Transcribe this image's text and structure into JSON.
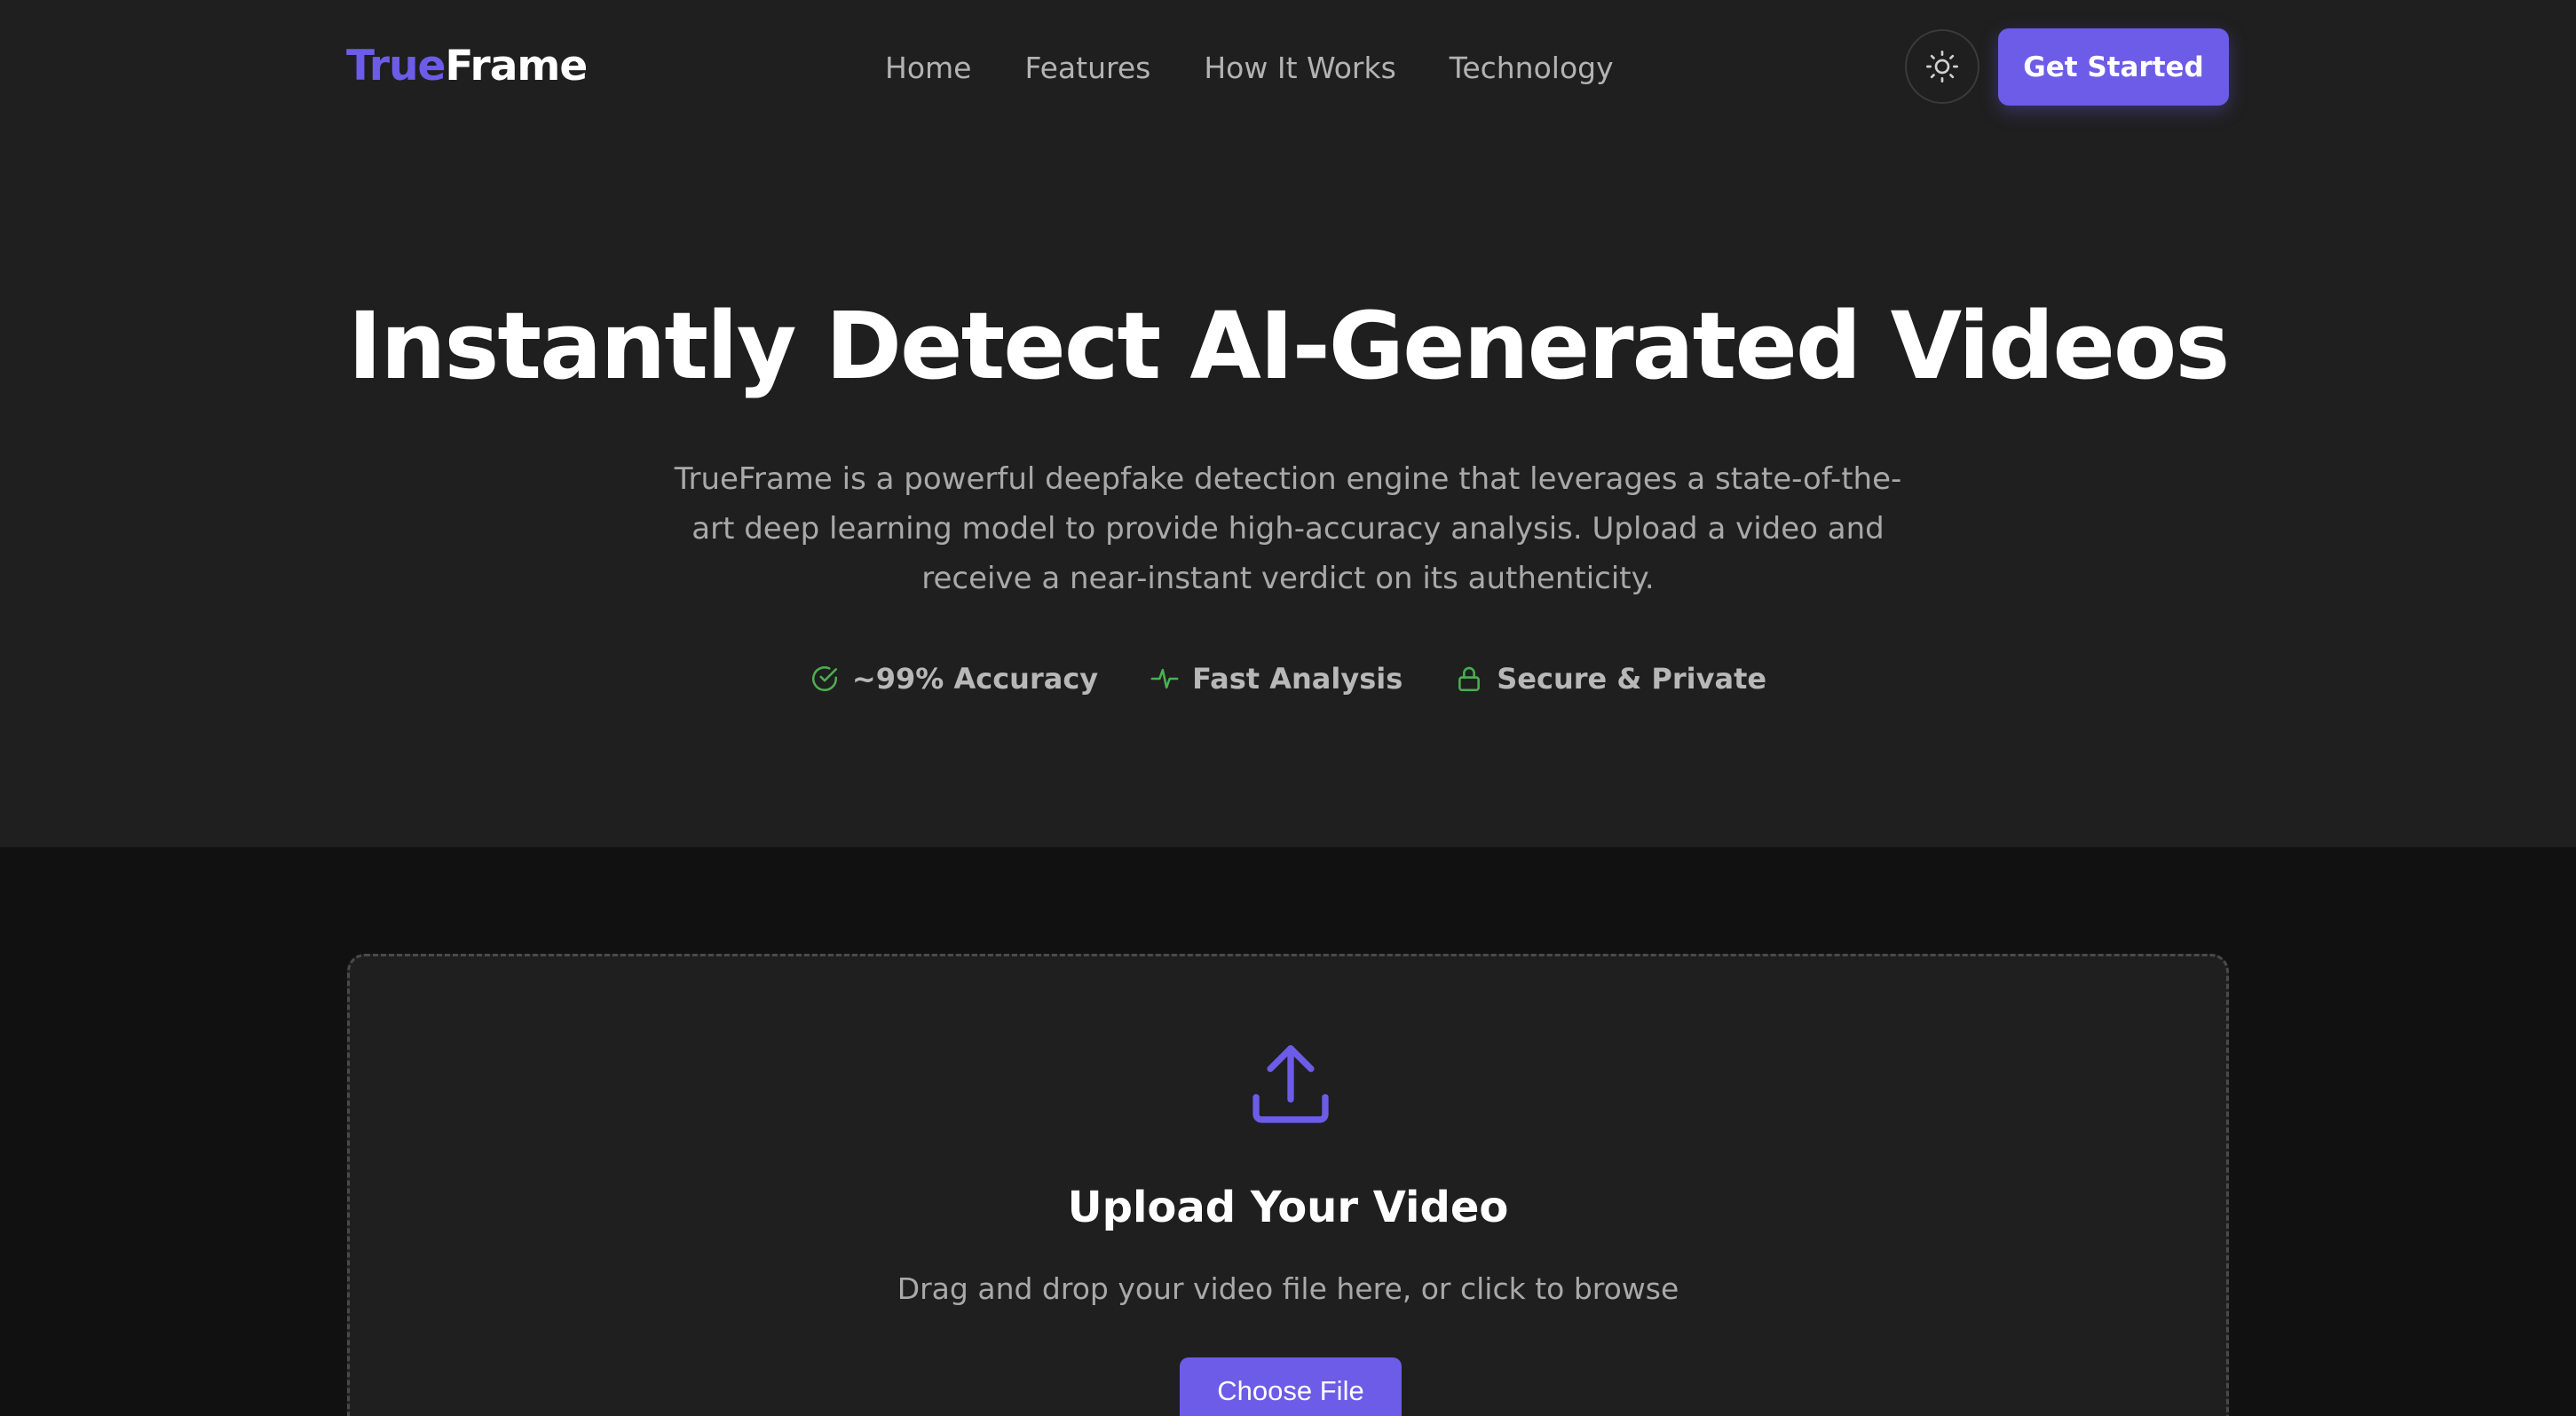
{
  "colors": {
    "accent": "#6c5ce7",
    "header_bg": "#1f1f1f",
    "page_bg": "#111111",
    "feature_icon": "#4caf50"
  },
  "header": {
    "logo_accent": "True",
    "logo_rest": "Frame",
    "nav": [
      {
        "label": "Home"
      },
      {
        "label": "Features"
      },
      {
        "label": "How It Works"
      },
      {
        "label": "Technology"
      }
    ],
    "theme_toggle_icon": "sun-icon",
    "cta_label": "Get Started"
  },
  "hero": {
    "title": "Instantly Detect AI-Generated Videos",
    "description": "TrueFrame is a powerful deepfake detection engine that leverages a state-of-the-art deep learning model to provide high-accuracy analysis. Upload a video and receive a near-instant verdict on its authenticity.",
    "features": [
      {
        "icon": "check-circle-icon",
        "label": "~99% Accuracy"
      },
      {
        "icon": "activity-icon",
        "label": "Fast Analysis"
      },
      {
        "icon": "lock-icon",
        "label": "Secure & Private"
      }
    ]
  },
  "upload": {
    "icon": "upload-icon",
    "title": "Upload Your Video",
    "subtitle": "Drag and drop your video file here, or click to browse",
    "button_label": "Choose File"
  }
}
